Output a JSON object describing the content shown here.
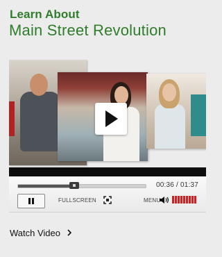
{
  "header": {
    "eyebrow": "Learn About",
    "title": "Main Street Revolution"
  },
  "video": {
    "play_icon": "play-icon",
    "progress_fraction": 0.44,
    "time_display": "00:36 / 01:37"
  },
  "controls": {
    "pause_icon": "pause-icon",
    "fullscreen_label": "FULLSCREEN",
    "fullscreen_icon": "fullscreen-icon",
    "menu_label": "MENU",
    "speaker_icon": "speaker-icon",
    "volume_segments": 9,
    "volume_color": "#d21f1f"
  },
  "footer": {
    "link_label": "Watch Video",
    "link_icon": "chevron-right-icon"
  },
  "colors": {
    "brand_green": "#2f7d2b",
    "background": "#ececec"
  }
}
